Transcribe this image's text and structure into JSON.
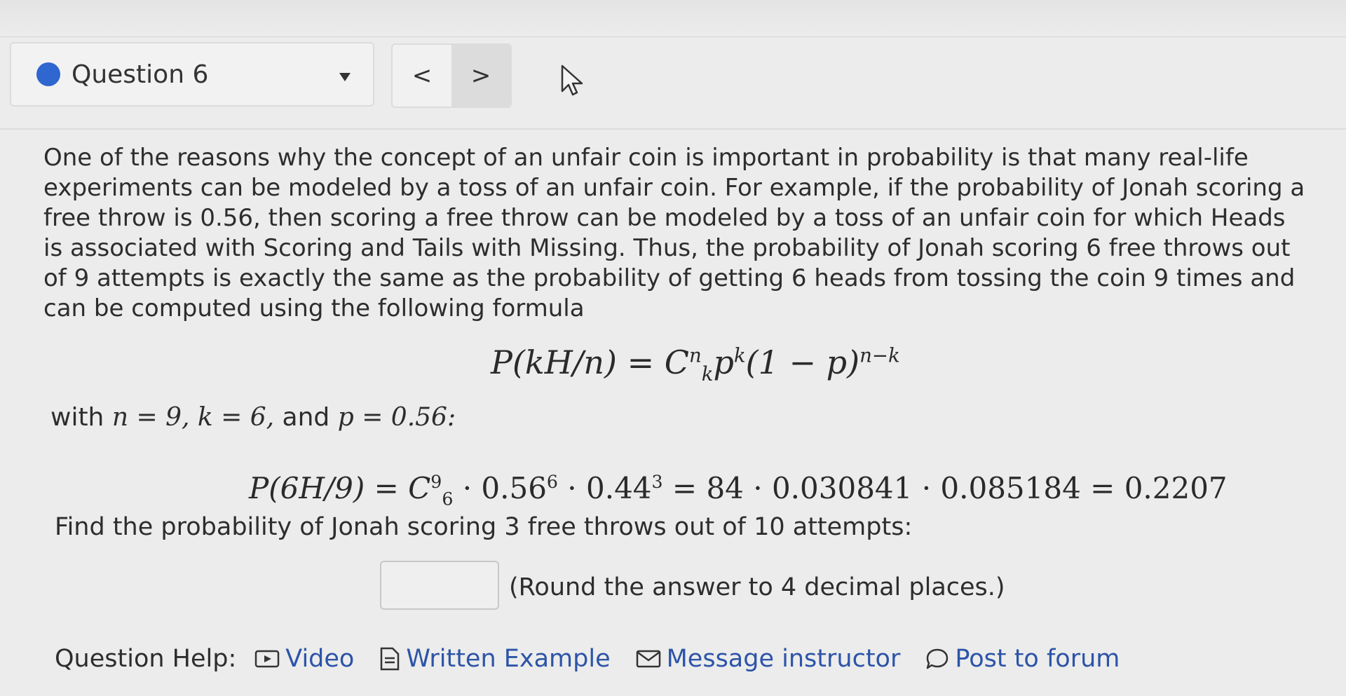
{
  "header": {
    "question_label": "Question 6",
    "prev": "<",
    "next": ">"
  },
  "question": {
    "paragraph": "One of the reasons why the concept of an unfair coin is important in probability is that many real-life experiments can be modeled by a toss of an unfair coin. For example, if the probability of Jonah scoring a free throw is 0.56, then scoring a free throw can be modeled by a toss of an unfair coin for which Heads is associated with Scoring and Tails with Missing. Thus, the probability of Jonah scoring 6 free throws out of 9 attempts is exactly the same as the probability of getting 6 heads from tossing the coin 9 times and can be computed using the following formula",
    "formula": "P(kH/n) = C",
    "formula_sup": "n",
    "formula_sub": "k",
    "formula_rest": "p",
    "formula_k": "k",
    "formula_tail": "(1 − p)",
    "formula_exp": "n−k",
    "with_prefix": "with ",
    "with_vars": "n = 9, k = 6,",
    "with_and": " and ",
    "with_p": "p = 0.56:",
    "calc_lhs": "P(6H/9) = C",
    "calc_sup": "9",
    "calc_sub": "6",
    "calc_mid": " · 0.56",
    "calc_exp1": "6",
    "calc_mid2": " · 0.44",
    "calc_exp2": "3",
    "calc_rhs": " = 84 · 0.030841 · 0.085184 = 0.2207",
    "find": "Find the probability of Jonah scoring 3 free throws out of 10 attempts:",
    "answer_value": "",
    "round_note": "(Round the answer to 4 decimal places.)"
  },
  "help": {
    "label": "Question Help:",
    "video": "Video",
    "written_example": "Written Example",
    "message": "Message instructor",
    "forum": "Post to forum"
  },
  "colors": {
    "accent": "#2f66cf",
    "link": "#2c54a8"
  }
}
